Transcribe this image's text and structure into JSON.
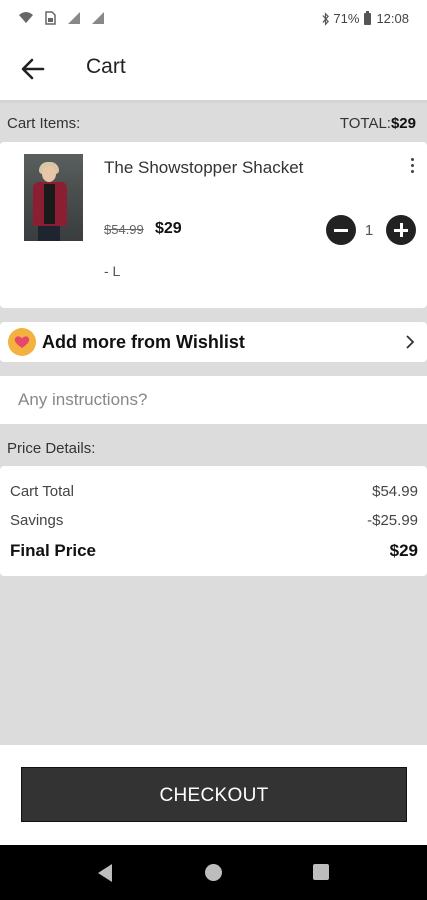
{
  "status_bar": {
    "battery_percent": "71%",
    "time": "12:08",
    "icons": [
      "wifi-icon",
      "sim-icon",
      "signal-icon",
      "signal-icon",
      "bluetooth-icon",
      "battery-icon"
    ]
  },
  "header": {
    "title": "Cart"
  },
  "cart_items_header": {
    "label": "Cart Items:",
    "total_label": "TOTAL:",
    "total_value": "$29"
  },
  "cart_items": [
    {
      "name": "The Showstopper Shacket",
      "original_price": "$54.99",
      "price": "$29",
      "quantity": "1",
      "size": "- L"
    }
  ],
  "wishlist": {
    "label": "Add more from Wishlist"
  },
  "instructions": {
    "placeholder": "Any instructions?"
  },
  "price_details": {
    "header": "Price Details:",
    "rows": [
      {
        "label": "Cart Total",
        "value": "$54.99"
      },
      {
        "label": "Savings",
        "value": "-$25.99"
      },
      {
        "label": "Final Price",
        "value": "$29"
      }
    ]
  },
  "checkout": {
    "label": "CHECKOUT"
  },
  "colors": {
    "accent_dark": "#333333",
    "wishlist_badge": "#f3b23f",
    "heart": "#e5486b",
    "background_gray": "#dcdcdc"
  }
}
